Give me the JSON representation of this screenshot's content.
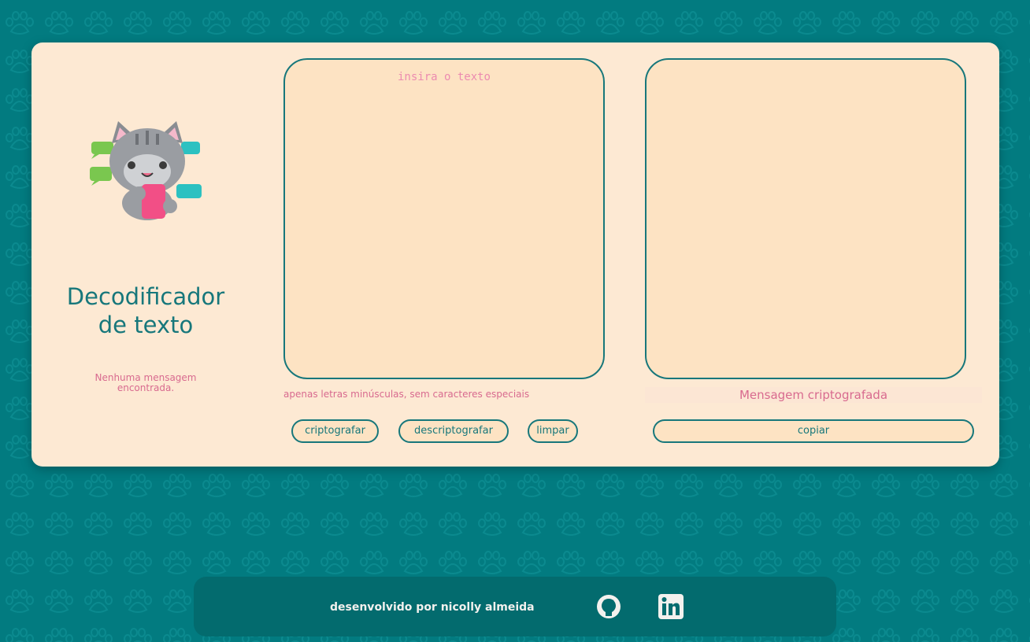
{
  "app": {
    "title_line1": "Decodificador",
    "title_line2": "de texto",
    "empty_message_line1": "Nenhuma mensagem",
    "empty_message_line2": "encontrada."
  },
  "input": {
    "placeholder": "insira o texto",
    "value": "",
    "hint": "apenas letras minúsculas, sem caracteres especiais"
  },
  "buttons": {
    "encrypt": "criptografar",
    "decrypt": "descriptografar",
    "clear": "limpar",
    "copy": "copiar"
  },
  "output": {
    "value": "",
    "label": "Mensagem criptografada"
  },
  "footer": {
    "text": "desenvolvido por nicolly almeida",
    "github_icon": "github-icon",
    "linkedin_icon": "linkedin-icon"
  },
  "colors": {
    "background": "#027b80",
    "card": "#fde9d3",
    "box": "#fde3c3",
    "accent": "#17777b",
    "pink": "#d86a8f",
    "footer": "#036b6e"
  }
}
